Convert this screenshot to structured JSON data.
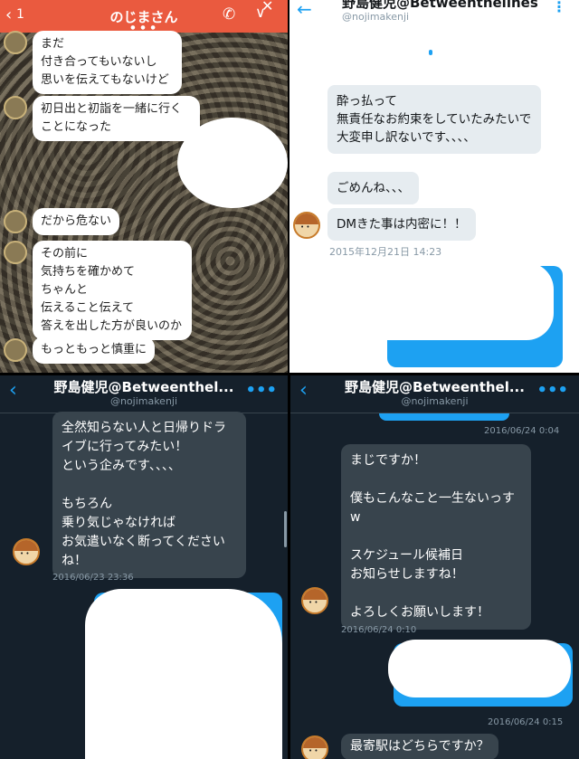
{
  "line_panel": {
    "title": "のじまさん",
    "back_badge": "1",
    "messages": [
      "まだ\n付き合ってもいないし\n思いを伝えてもないけど",
      "初日出と初詣を一緒に行くことになった",
      "だから危ない",
      "その前に\n気持ちを確かめて\nちゃんと\n伝えること伝えて\n答えを出した方が良いのか",
      "もっともっと慎重に"
    ]
  },
  "light_panel": {
    "name": "野島健児@Betweenthelines",
    "handle": "@nojimakenji",
    "messages": [
      "酔っ払って\n無責任なお約束をしていたみたいで\n大変申し訳ないです、、、、",
      "ごめんね、、、",
      "DMきた事は内密に！！"
    ],
    "timestamp": "2015年12月21日 14:23"
  },
  "dark_left": {
    "name": "野島健児@Betweenthel...",
    "handle": "@nojimakenji",
    "message": "全然知らない人と日帰りドライブに行ってみたい！\nという企みです、、、、\n\nもちろん\n乗り気じゃなければ\nお気遣いなく断ってくださいね！",
    "timestamp": "2016/06/23 23:36"
  },
  "dark_right": {
    "name": "野島健児@Betweenthel...",
    "handle": "@nojimakenji",
    "timestamps": [
      "2016/06/24 0:04",
      "2016/06/24 0:10",
      "2016/06/24 0:15"
    ],
    "message": "まじですか！\n\n僕もこんなこと一生ないっすw\n\nスケジュール候補日\nお知らせしますね！\n\nよろしくお願いします！",
    "last_message": "最寄駅はどちらですか？"
  },
  "colors": {
    "line_header": "#ea5a3f",
    "twitter_blue": "#1da1f2",
    "dark_bg": "#15202b",
    "dark_bubble": "#38444d"
  }
}
